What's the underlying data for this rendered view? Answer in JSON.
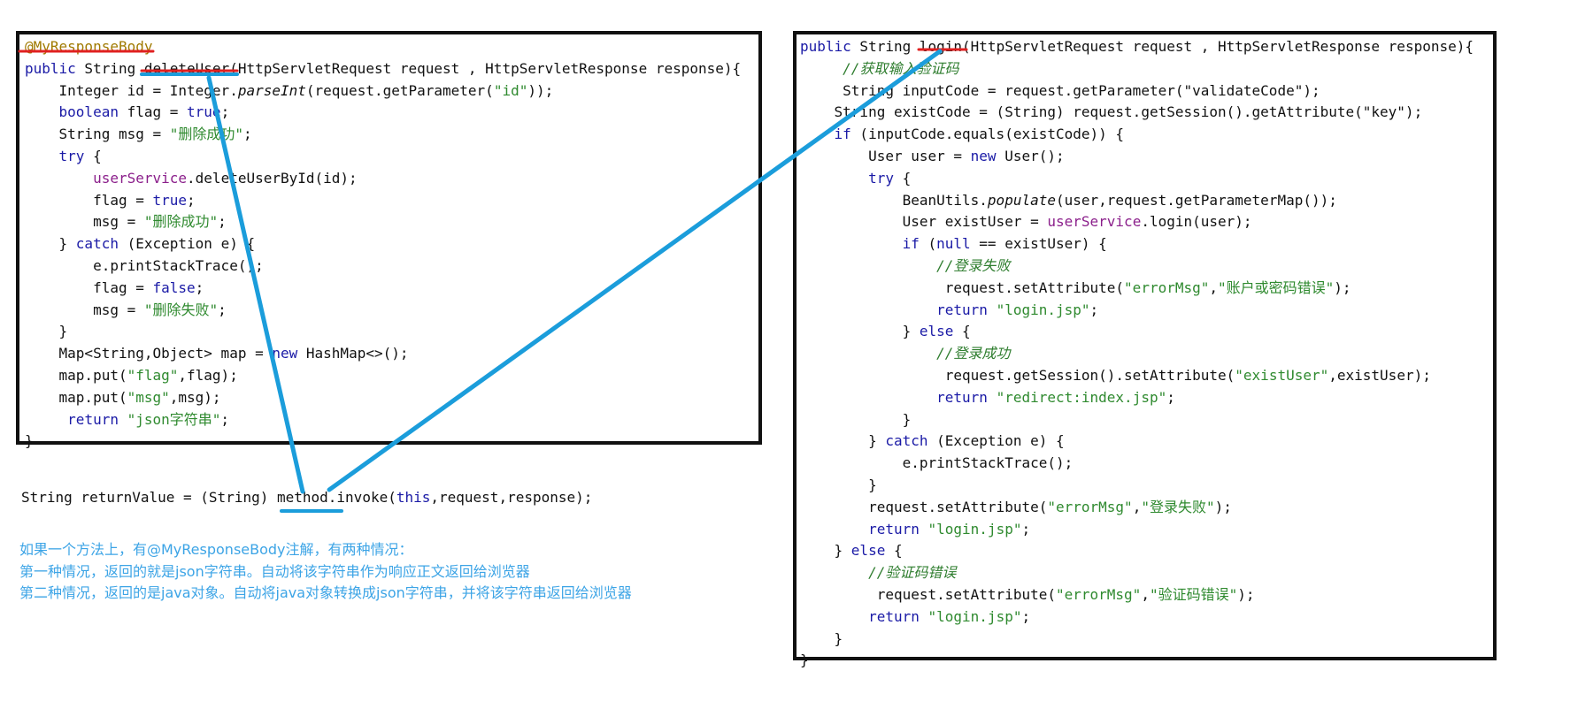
{
  "colors": {
    "arrow": "#1b9ddb",
    "underline_red": "#e02020",
    "notes_text": "#3ca4e6",
    "keyword": "#1a1aa6",
    "string": "#2f8a2f",
    "field": "#8b1f8b",
    "annotation": "#a07a00"
  },
  "left_code": {
    "l0": "@MyResponseBody",
    "l1": [
      "public",
      " String ",
      "deleteUser",
      "(HttpServletRequest request , HttpServletResponse response){"
    ],
    "l2": [
      "    Integer id = Integer.",
      "parseInt",
      "(request.getParameter(",
      "\"id\"",
      "));"
    ],
    "l3": [
      "    ",
      "boolean",
      " flag = ",
      "true",
      ";"
    ],
    "l4": [
      "    String msg = ",
      "\"删除成功\"",
      ";"
    ],
    "l5": [
      "    ",
      "try",
      " {"
    ],
    "l6": [
      "        ",
      "userService",
      ".deleteUserById(id);"
    ],
    "l7": [
      "        flag = ",
      "true",
      ";"
    ],
    "l8": [
      "        msg = ",
      "\"删除成功\"",
      ";"
    ],
    "l9": [
      "    } ",
      "catch",
      " (Exception e) {"
    ],
    "l10": "        e.printStackTrace();",
    "l11": [
      "        flag = ",
      "false",
      ";"
    ],
    "l12": [
      "        msg = ",
      "\"删除失败\"",
      ";"
    ],
    "l13": "    }",
    "l14": [
      "    Map<String,Object> map = ",
      "new",
      " HashMap<>();"
    ],
    "l15": [
      "    map.put(",
      "\"flag\"",
      ",flag);"
    ],
    "l16": [
      "    map.put(",
      "\"msg\"",
      ",msg);"
    ],
    "l17": [
      "     ",
      "return",
      " ",
      "\"json字符串\"",
      ";"
    ],
    "l18": "}"
  },
  "right_code": {
    "r0": [
      "public",
      " String ",
      "login",
      "(HttpServletRequest request , HttpServletResponse response){"
    ],
    "r1": [
      "     ",
      "//获取输入验证码"
    ],
    "r2": "     String inputCode = request.getParameter(\"validateCode\");",
    "r3": "    String existCode = (String) request.getSession().getAttribute(\"key\");",
    "r4": [
      "    ",
      "if",
      " (inputCode.equals(existCode)) {"
    ],
    "r5": [
      "        User user = ",
      "new",
      " User();"
    ],
    "r6": [
      "        ",
      "try",
      " {"
    ],
    "r7": [
      "            BeanUtils.",
      "populate",
      "(user,request.getParameterMap());"
    ],
    "r8": [
      "            User existUser = ",
      "userService",
      ".login(user);"
    ],
    "r9": [
      "            ",
      "if",
      " (",
      "null",
      " == existUser) {"
    ],
    "r10": [
      "                ",
      "//登录失败"
    ],
    "r11": [
      "                 request.setAttribute(",
      "\"errorMsg\"",
      ",",
      "\"账户或密码错误\"",
      ");"
    ],
    "r12": [
      "                ",
      "return",
      " ",
      "\"login.jsp\"",
      ";"
    ],
    "r13": [
      "            } ",
      "else",
      " {"
    ],
    "r14": [
      "                ",
      "//登录成功"
    ],
    "r15": [
      "                 request.getSession().setAttribute(",
      "\"existUser\"",
      ",existUser);"
    ],
    "r16": [
      "                ",
      "return",
      " ",
      "\"redirect:index.jsp\"",
      ";"
    ],
    "r17": "            }",
    "r18": [
      "        } ",
      "catch",
      " (Exception e) {"
    ],
    "r19": "            e.printStackTrace();",
    "r20": "        }",
    "r21": [
      "        request.setAttribute(",
      "\"errorMsg\"",
      ",",
      "\"登录失败\"",
      ");"
    ],
    "r22": [
      "        ",
      "return",
      " ",
      "\"login.jsp\"",
      ";"
    ],
    "r23": [
      "    } ",
      "else",
      " {"
    ],
    "r24": [
      "        ",
      "//验证码错误"
    ],
    "r25": [
      "         request.setAttribute(",
      "\"errorMsg\"",
      ",",
      "\"验证码错误\"",
      ");"
    ],
    "r26": [
      "        ",
      "return",
      " ",
      "\"login.jsp\"",
      ";"
    ],
    "r27": "    }",
    "r28": "}"
  },
  "invoke": [
    "String returnValue = (String) ",
    "method",
    ".invoke(",
    "this",
    ",request,response);"
  ],
  "notes": [
    "如果一个方法上，有@MyResponseBody注解，有两种情况：",
    "第一种情况，返回的就是json字符串。自动将该字符串作为响应正文返回给浏览器",
    "第二种情况，返回的是java对象。自动将java对象转换成json字符串，并将该字符串返回给浏览器"
  ]
}
